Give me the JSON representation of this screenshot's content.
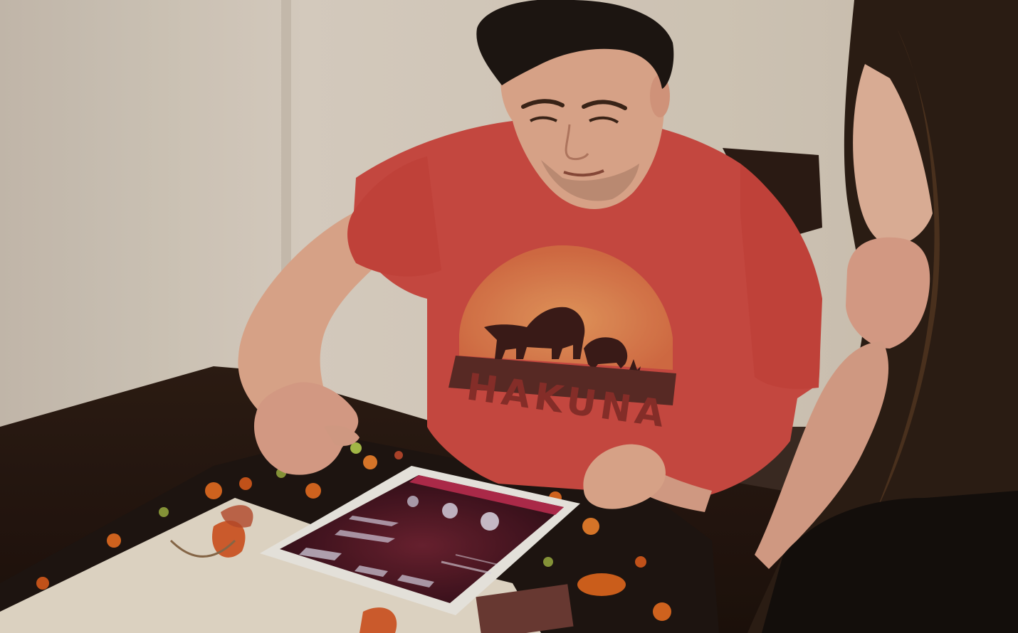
{
  "scene": {
    "description_tag": "photo",
    "shirt_print_text": "HAKUNA",
    "colors": {
      "wall": "#d8cfc2",
      "wall_shadow": "#b9ab9a",
      "table": "#24160f",
      "shirt": "#cc4a42",
      "shirt_print": "#e0874f",
      "skin": "#e1a98e",
      "hair": "#1b1512",
      "tablet_frame": "#efece6",
      "tablet_screen": "#4a1624",
      "tablet_header": "#b22a4c",
      "placemat_beige": "#e6dccb",
      "placemat_dark": "#1c1410",
      "pumpkin": "#d8661f"
    }
  }
}
